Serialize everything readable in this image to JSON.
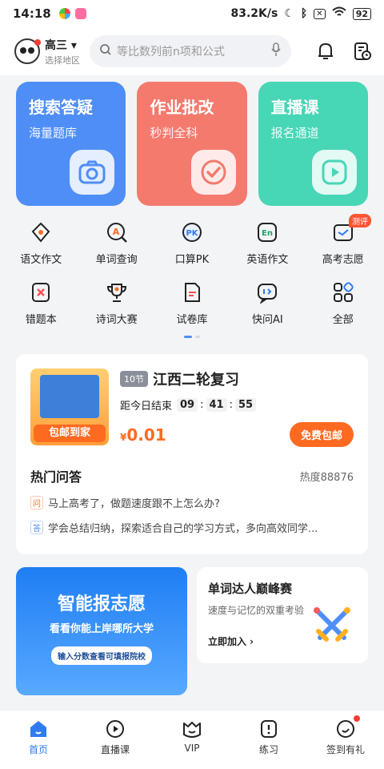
{
  "status_bar": {
    "time": "14:18",
    "speed": "83.2K/s",
    "battery": "92"
  },
  "header": {
    "grade": "高三",
    "region_hint": "选择地区",
    "search_placeholder": "等比数列前n项和公式"
  },
  "big_cards": [
    {
      "title": "搜索答疑",
      "subtitle": "海量题库",
      "icon": "camera-icon",
      "color": "#4f8ef6"
    },
    {
      "title": "作业批改",
      "subtitle": "秒判全科",
      "icon": "check-icon",
      "color": "#f47a6e"
    },
    {
      "title": "直播课",
      "subtitle": "报名通道",
      "icon": "play-icon",
      "color": "#47d6b6"
    }
  ],
  "grid_items": [
    {
      "label": "语文作文",
      "icon": "pen-nib-icon"
    },
    {
      "label": "单词查询",
      "icon": "word-search-icon"
    },
    {
      "label": "口算PK",
      "icon": "pk-icon"
    },
    {
      "label": "英语作文",
      "icon": "english-icon"
    },
    {
      "label": "高考志愿",
      "icon": "calendar-icon",
      "badge": "测评"
    },
    {
      "label": "错题本",
      "icon": "wrong-book-icon"
    },
    {
      "label": "诗词大赛",
      "icon": "trophy-icon"
    },
    {
      "label": "试卷库",
      "icon": "paper-icon"
    },
    {
      "label": "快问AI",
      "icon": "ai-chat-icon"
    },
    {
      "label": "全部",
      "icon": "all-grid-icon"
    }
  ],
  "promo": {
    "book_label": "包邮到家",
    "lessons": "10节",
    "title": "江西二轮复习",
    "countdown_label": "距今日结束",
    "h": "09",
    "m": "41",
    "s": "55",
    "currency": "¥",
    "price": "0.01",
    "button": "免费包邮"
  },
  "qa": {
    "title": "热门问答",
    "heat": "热度88876",
    "q_tag": "问",
    "question": "马上高考了，做题速度跟不上怎么办?",
    "a_tag": "答",
    "answer": "学会总结归纳，探索适合自己的学习方式，多向高效同学..."
  },
  "banner": {
    "line1": "智能报志愿",
    "line2": "看看你能上岸哪所大学",
    "line3": "输入分数查看可填报院校"
  },
  "contest": {
    "title": "单词达人巅峰赛",
    "subtitle": "速度与记忆的双重考验",
    "cta": "立即加入 ›"
  },
  "tabs": [
    {
      "label": "首页",
      "icon": "home-icon",
      "active": true
    },
    {
      "label": "直播课",
      "icon": "live-icon"
    },
    {
      "label": "VIP",
      "icon": "vip-icon"
    },
    {
      "label": "练习",
      "icon": "practice-icon"
    },
    {
      "label": "签到有礼",
      "icon": "checkin-icon",
      "dot": true
    }
  ]
}
